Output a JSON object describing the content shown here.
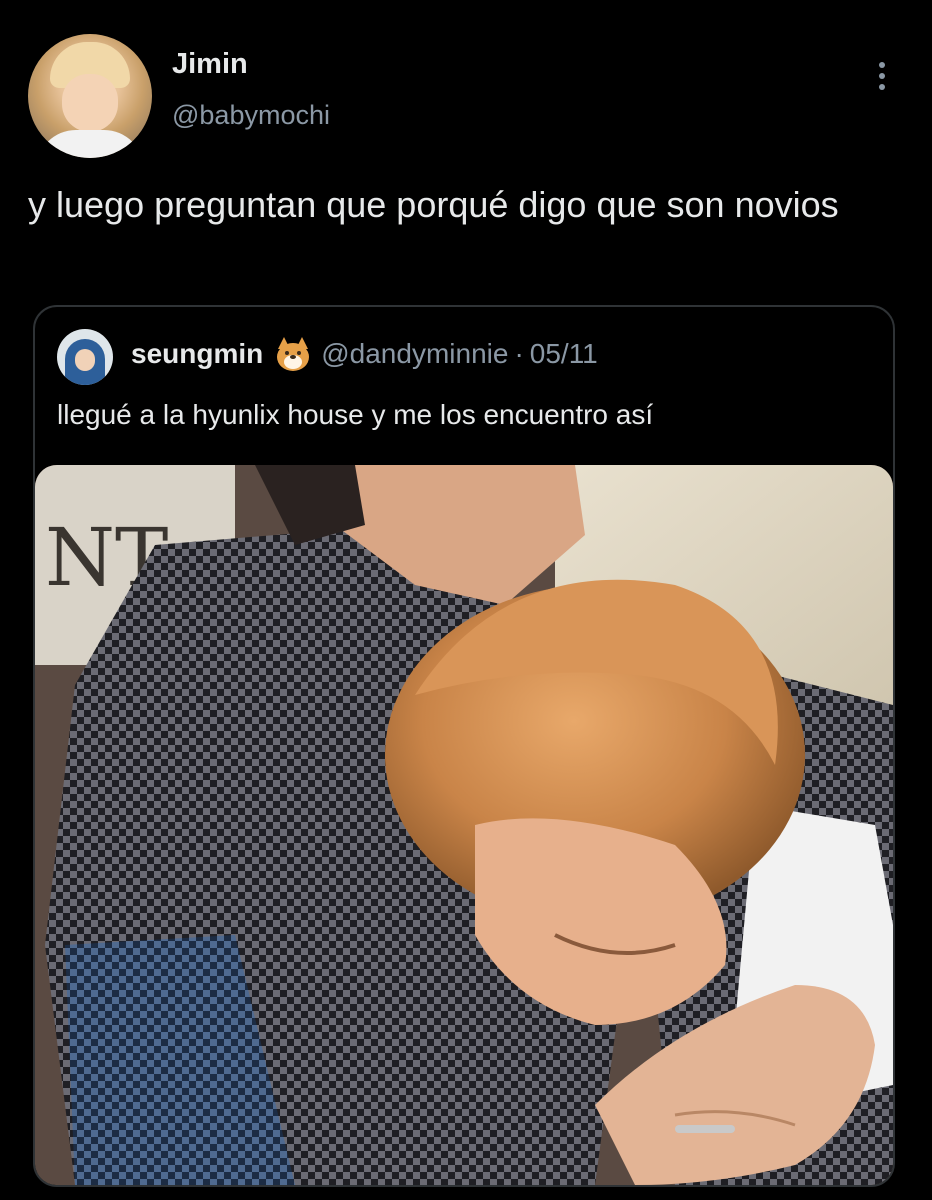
{
  "tweet": {
    "author": {
      "display_name": "Jimin",
      "handle": "@babymochi"
    },
    "text": "y luego preguntan que porqué digo que son novios",
    "more_icon": "more-vertical-icon"
  },
  "quoted_tweet": {
    "author": {
      "display_name": "seungmin",
      "emoji_icon": "dog-face-icon",
      "handle": "@dandyminnie"
    },
    "separator": "·",
    "date": "05/11",
    "text": "llegué a la hyunlix house y me los encuentro así"
  },
  "colors": {
    "background": "#000000",
    "primary_text": "#e7e9ea",
    "secondary_text": "#8b98a5",
    "border": "#2f3336"
  }
}
